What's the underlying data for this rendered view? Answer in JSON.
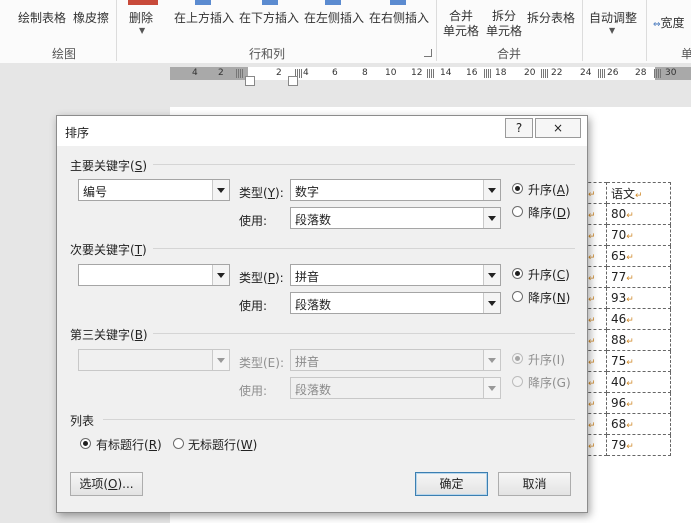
{
  "ribbon": {
    "draw_table": "绘制表格",
    "eraser": "橡皮擦",
    "delete": "删除",
    "insert_above": "在上方插入",
    "insert_below": "在下方插入",
    "insert_left": "在左侧插入",
    "insert_right": "在右侧插入",
    "merge_cells_1": "合并",
    "merge_cells_2": "单元格",
    "split_cells_1": "拆分",
    "split_cells_2": "单元格",
    "split_table": "拆分表格",
    "autofit": "自动调整",
    "width": "宽度",
    "group_draw": "绘图",
    "group_rows_cols": "行和列",
    "group_merge": "合并",
    "group_cell_size_partial": "单"
  },
  "ruler": {
    "numbers": [
      "4",
      "2",
      "2",
      "4",
      "6",
      "8",
      "10",
      "12",
      "14",
      "16",
      "18",
      "20",
      "22",
      "24",
      "26",
      "28",
      "30"
    ]
  },
  "document": {
    "header_cell": "语文",
    "scores": [
      "80",
      "70",
      "65",
      "77",
      "93",
      "46",
      "88",
      "75",
      "40",
      "96",
      "68",
      "79"
    ]
  },
  "dialog": {
    "title": "排序",
    "help": "?",
    "close": "×",
    "primary": {
      "section_label": "主要关键字(",
      "section_key": "S",
      "keyword": "编号",
      "type_label": "类型(",
      "type_key": "Y",
      "type_value": "数字",
      "use_label": "使用:",
      "use_value": "段落数",
      "asc_label": "升序(",
      "asc_key": "A",
      "desc_label": "降序(",
      "desc_key": "D"
    },
    "secondary": {
      "section_label": "次要关键字(",
      "section_key": "T",
      "keyword": "",
      "type_label": "类型(",
      "type_key": "P",
      "type_value": "拼音",
      "use_label": "使用:",
      "use_value": "段落数",
      "asc_label": "升序(",
      "asc_key": "C",
      "desc_label": "降序(",
      "desc_key": "N"
    },
    "tertiary": {
      "section_label": "第三关键字(",
      "section_key": "B",
      "keyword": "",
      "type_label": "类型(E):",
      "type_value": "拼音",
      "use_label": "使用:",
      "use_value": "段落数",
      "asc_label": "升序(I)",
      "desc_label": "降序(G)"
    },
    "list": {
      "section_label": "列表",
      "header_row_label": "有标题行(",
      "header_row_key": "R",
      "no_header_row_label": "无标题行(",
      "no_header_row_key": "W"
    },
    "options_button": "选项(",
    "options_key": "O",
    "options_suffix": ")...",
    "ok_button": "确定",
    "cancel_button": "取消"
  }
}
